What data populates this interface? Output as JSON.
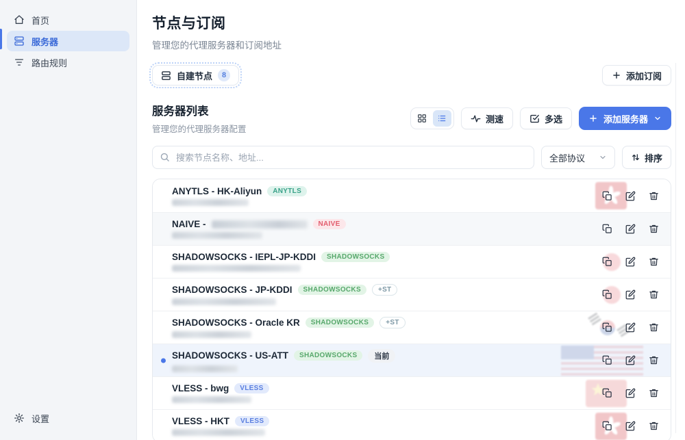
{
  "sidebar": {
    "items": [
      {
        "label": "首页",
        "icon": "home-icon"
      },
      {
        "label": "服务器",
        "icon": "server-icon",
        "active": true
      },
      {
        "label": "路由规则",
        "icon": "routes-icon"
      }
    ],
    "settings_label": "设置"
  },
  "header": {
    "title": "节点与订阅",
    "subtitle": "管理您的代理服务器和订阅地址"
  },
  "tabs": {
    "self_built": {
      "label": "自建节点",
      "count": "8"
    },
    "add_subscription_label": "添加订阅"
  },
  "server_list": {
    "title": "服务器列表",
    "subtitle": "管理您的代理服务器配置",
    "speed_test_label": "测速",
    "multi_select_label": "多选",
    "add_server_label": "添加服务器"
  },
  "filters": {
    "search_placeholder": "搜索节点名称、地址...",
    "protocol_filter": "全部协议",
    "sort_label": "排序"
  },
  "servers": [
    {
      "name": "ANYTLS - HK-Aliyun",
      "badges": [
        {
          "label": "ANYTLS",
          "type": "anytls"
        }
      ],
      "flag": "hk",
      "addr_width": 112
    },
    {
      "name": "NAIVE - ",
      "name_blur_width": 140,
      "badges": [
        {
          "label": "NAIVE",
          "type": "naive"
        }
      ],
      "flag": "",
      "row_style": "tint",
      "addr_width": 132
    },
    {
      "name": "SHADOWSOCKS - IEPL-JP-KDDI",
      "badges": [
        {
          "label": "SHADOWSOCKS",
          "type": "shadowsocks"
        }
      ],
      "flag": "jp",
      "addr_width": 188
    },
    {
      "name": "SHADOWSOCKS - JP-KDDI",
      "badges": [
        {
          "label": "SHADOWSOCKS",
          "type": "shadowsocks"
        },
        {
          "label": "+ST",
          "type": "st"
        }
      ],
      "flag": "jp",
      "addr_width": 152
    },
    {
      "name": "SHADOWSOCKS - Oracle KR",
      "badges": [
        {
          "label": "SHADOWSOCKS",
          "type": "shadowsocks"
        },
        {
          "label": "+ST",
          "type": "st"
        }
      ],
      "flag": "kr",
      "addr_width": 116
    },
    {
      "name": "SHADOWSOCKS - US-ATT",
      "badges": [
        {
          "label": "SHADOWSOCKS",
          "type": "shadowsocks"
        }
      ],
      "current_label": "当前",
      "flag": "us",
      "row_style": "active",
      "current": true,
      "addr_width": 96
    },
    {
      "name": "VLESS - bwg",
      "badges": [
        {
          "label": "VLESS",
          "type": "vless"
        }
      ],
      "flag": "cn",
      "addr_width": 116
    },
    {
      "name": "VLESS - HKT",
      "badges": [
        {
          "label": "VLESS",
          "type": "vless"
        }
      ],
      "flag": "hk",
      "addr_width": 136
    }
  ],
  "icons": {
    "copy": "overlapping-squares",
    "edit": "pencil-square",
    "delete": "trash-can",
    "speed_test": "activity-pulse",
    "multi_select": "check-square",
    "view_grid": "grid",
    "view_list": "list",
    "search": "magnifier",
    "sort": "up-down-arrows",
    "add": "plus",
    "expand": "chevron-down"
  },
  "colors": {
    "accent": "#4a77e8",
    "sidebar_active_bg": "#dce7f8",
    "active_row_bg": "#eff4fc",
    "badge_anytls": "#38a188",
    "badge_naive": "#e25c6d",
    "badge_shadowsocks": "#57a86b",
    "badge_vless": "#5a7fe0"
  }
}
